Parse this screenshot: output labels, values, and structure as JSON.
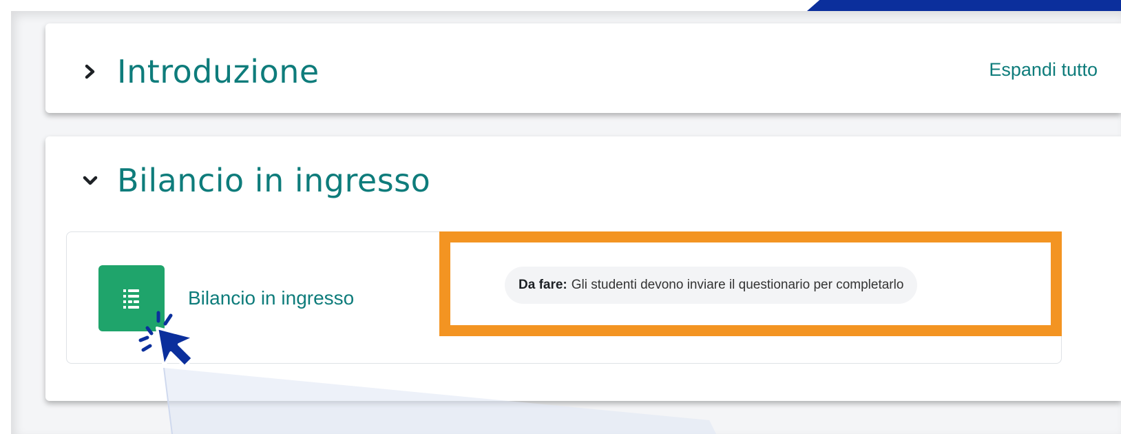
{
  "sections": [
    {
      "title": "Introduzione",
      "state": "collapsed",
      "icon": "chevron-right-icon"
    },
    {
      "title": "Bilancio in ingresso",
      "state": "expanded",
      "icon": "chevron-down-icon",
      "activity": {
        "name": "Bilancio in ingresso",
        "icon": "questionnaire-icon",
        "completion": {
          "label": "Da fare:",
          "text": "Gli studenti devono inviare il questionario per completarlo"
        }
      }
    }
  ],
  "controls": {
    "expand_all_label": "Espandi tutto"
  },
  "colors": {
    "accent_teal": "#0e7c7b",
    "activity_icon_bg": "#1fa46b",
    "highlight_orange": "#f39422",
    "cursor_blue": "#0b2f9c"
  }
}
